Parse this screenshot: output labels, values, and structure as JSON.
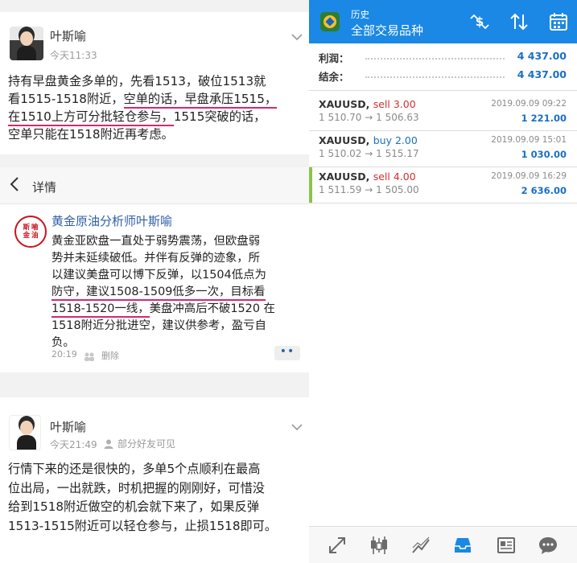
{
  "post1": {
    "author": "叶斯喻",
    "time": "今天11:33",
    "lines": [
      {
        "a": "持有早盘黄金多单的，先看1513，破位1513就"
      },
      {
        "a": "看1515-1518附近，",
        "u": "空单的话，早盘承压1515，"
      },
      {
        "u": "在1510上方可分批轻仓参与，",
        "a": "1515突破的话，"
      },
      {
        "a": "空单只能在1518附近再考虑。"
      }
    ]
  },
  "detail": {
    "title": "详情",
    "seal_chars": [
      "斯",
      "喻",
      "金",
      "油"
    ],
    "author": "黄金原油分析师叶斯喻",
    "lines": [
      {
        "a": "黄金亚欧盘一直处于弱势震荡，但欧盘弱"
      },
      {
        "a": "势并未延续破低。并伴有反弹的迹象，所"
      },
      {
        "a": "以建议美盘可以博下反弹，以1504低点为"
      },
      {
        "u": "防守，建议1508-1509低多一次，目标看"
      },
      {
        "u": "1518-1520一线，",
        "a": "美盘冲高后不破1520 在"
      },
      {
        "a": "1518附近分批进空，建议供参考，盈亏自"
      },
      {
        "a": "负。"
      }
    ],
    "time": "20:19",
    "delete_label": "删除",
    "more_label": "••"
  },
  "post3": {
    "author": "叶斯喻",
    "time": "今天21:49",
    "visibility": "部分好友可见",
    "lines": [
      "行情下来的还是很快的，多单5个点顺利在最高",
      "位出局，一出就跌，时机把握的刚刚好，可惜没",
      "给到1518附近做空的机会就下来了，如果反弹",
      "1513-1515附近可以轻仓参与，止损1518即可。"
    ]
  },
  "mt": {
    "header_small": "历史",
    "header_title": "全部交易品种",
    "summary": [
      {
        "label": "利润：",
        "value": "4 437.00"
      },
      {
        "label": "结余：",
        "value": "4 437.00"
      }
    ],
    "deals": [
      {
        "symbol": "XAUUSD,",
        "side": "sell 3.00",
        "side_type": "sell",
        "open": "1 510.70",
        "close": "1 506.63",
        "datetime": "2019.09.09 09:22",
        "profit": "1 221.00",
        "active": false
      },
      {
        "symbol": "XAUUSD,",
        "side": "buy 2.00",
        "side_type": "buy",
        "open": "1 510.02",
        "close": "1 515.17",
        "datetime": "2019.09.09 15:01",
        "profit": "1 030.00",
        "active": false
      },
      {
        "symbol": "XAUUSD,",
        "side": "sell 4.00",
        "side_type": "sell",
        "open": "1 511.59",
        "close": "1 505.00",
        "datetime": "2019.09.09 16:29",
        "profit": "2 636.00",
        "active": true
      }
    ],
    "arrow": "→",
    "colors": {
      "accent": "#1a88e4",
      "sell": "#d32f2f",
      "buy": "#1a6fc4",
      "active_mark": "#8bc34a"
    }
  }
}
